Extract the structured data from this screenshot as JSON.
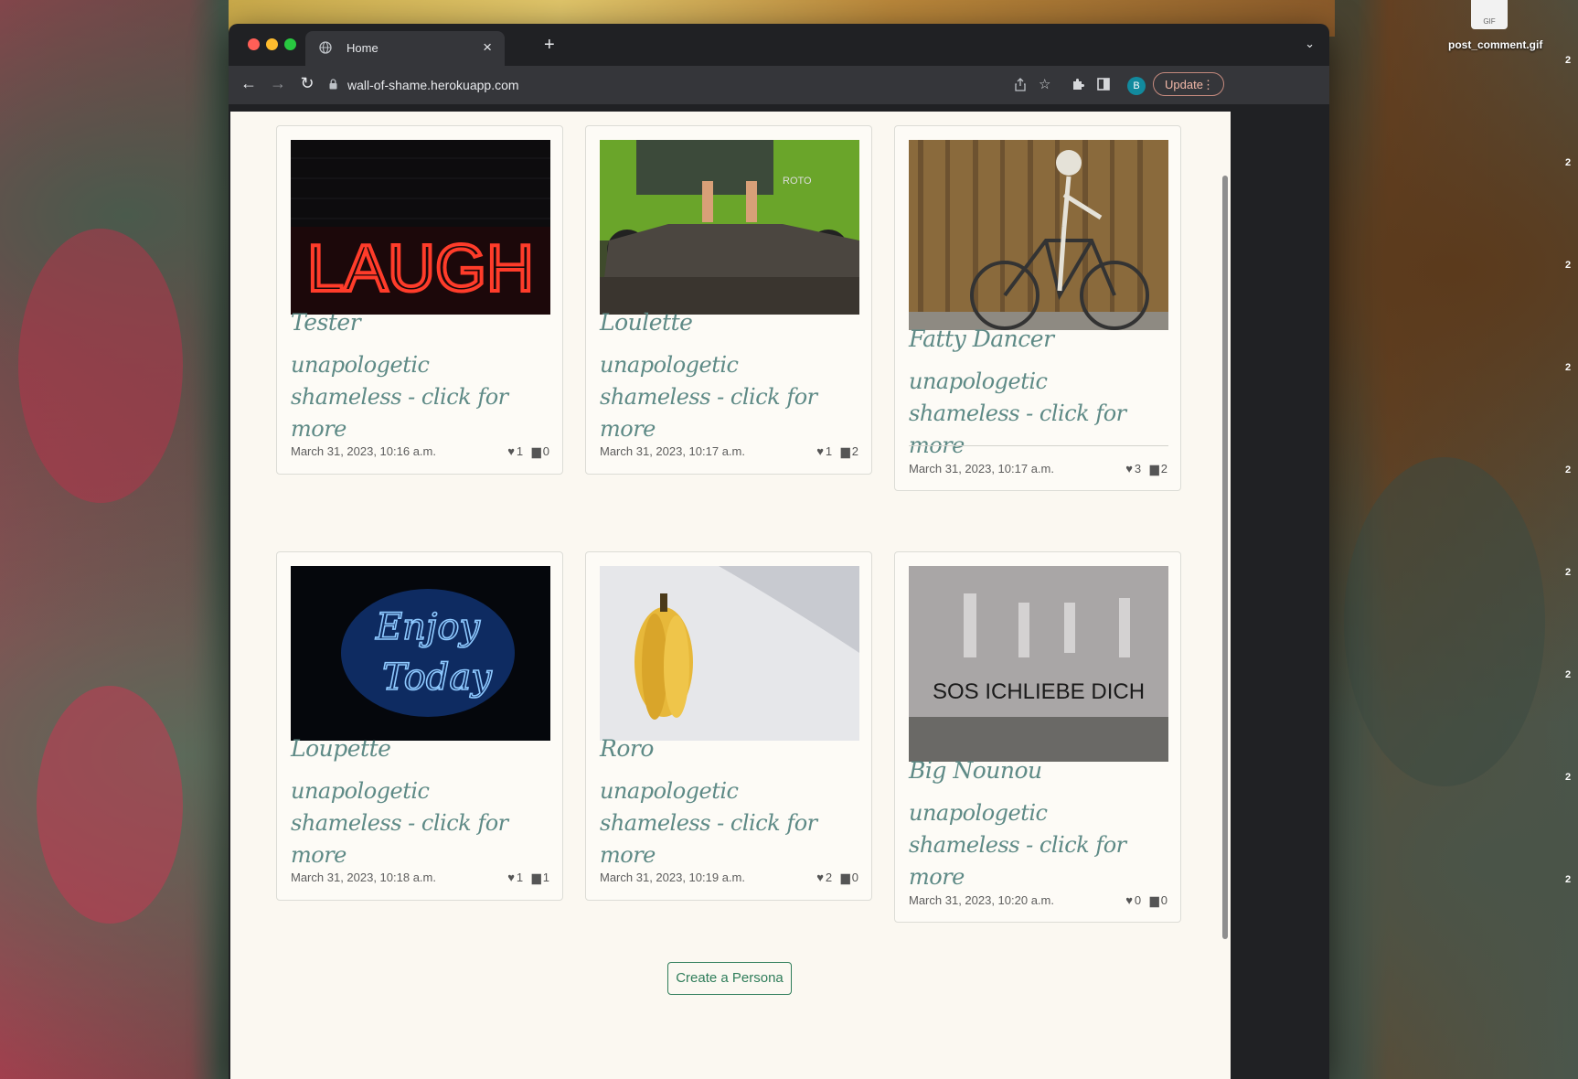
{
  "desktop": {
    "file_name": "post_comment.gif",
    "file_thumb_label": "GIF",
    "edge_digits": [
      "2",
      "2",
      "2",
      "2",
      "2",
      "2",
      "2",
      "2",
      "2"
    ]
  },
  "browser": {
    "tab_title": "Home",
    "url": "wall-of-shame.herokuapp.com",
    "profile_initial": "B",
    "update_label": "Update"
  },
  "cards": [
    {
      "name": "Tester",
      "description": "unapologetic shameless - click for more",
      "date": "March 31, 2023, 10:16 a.m.",
      "likes": "1",
      "comments": "0",
      "image": "laugh-neon-sign"
    },
    {
      "name": "Loulette",
      "description": "unapologetic shameless - click for more",
      "date": "March 31, 2023, 10:17 a.m.",
      "likes": "1",
      "comments": "2",
      "image": "feet-over-machine"
    },
    {
      "name": "Fatty Dancer",
      "description": "unapologetic shameless - click for more",
      "date": "March 31, 2023, 10:17 a.m.",
      "likes": "3",
      "comments": "2",
      "image": "skeleton-bicycle"
    },
    {
      "name": "Loupette",
      "description": "unapologetic shameless - click for more",
      "date": "March 31, 2023, 10:18 a.m.",
      "likes": "1",
      "comments": "1",
      "image": "enjoy-today-neon"
    },
    {
      "name": "Roro",
      "description": "unapologetic shameless - click for more",
      "date": "March 31, 2023, 10:19 a.m.",
      "likes": "2",
      "comments": "0",
      "image": "bananas"
    },
    {
      "name": "Big Nounou",
      "description": "unapologetic shameless - click for more",
      "date": "March 31, 2023, 10:20 a.m.",
      "likes": "0",
      "comments": "0",
      "image": "graffiti-wall"
    }
  ],
  "image_texts": {
    "laugh": "LAUGH",
    "roto": "ROTO",
    "enjoy": "Enjoy",
    "today": "Today",
    "graffiti": "SOS ICHLIEBE DICH"
  },
  "create_button_label": "Create a Persona",
  "colors": {
    "accent_teal": "#5e8a86",
    "button_green": "#2f7d5a",
    "page_bg": "#fbf8f1"
  }
}
